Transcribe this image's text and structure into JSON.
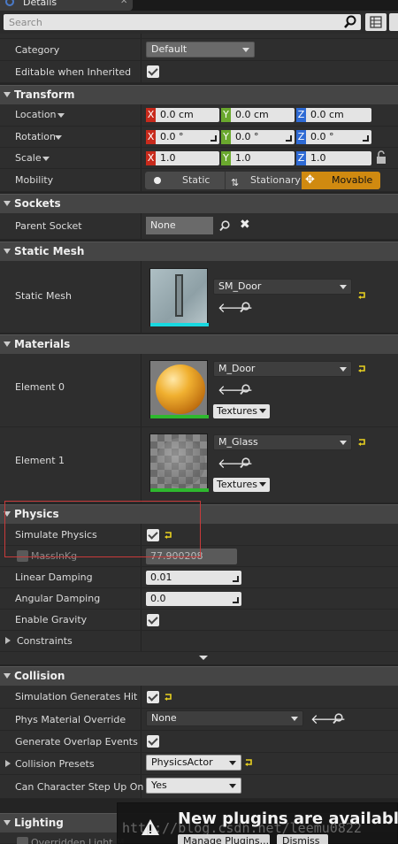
{
  "window": {
    "tab_title": "Details",
    "search_placeholder": "Search"
  },
  "top": {
    "category": {
      "label": "Category",
      "value": "Default"
    },
    "editable_inherited": {
      "label": "Editable when Inherited",
      "checked": true
    }
  },
  "transform": {
    "title": "Transform",
    "location": {
      "label": "Location",
      "x": "0.0 cm",
      "y": "0.0 cm",
      "z": "0.0 cm"
    },
    "rotation": {
      "label": "Rotation",
      "x": "0.0 °",
      "y": "0.0 °",
      "z": "0.0 °"
    },
    "scale": {
      "label": "Scale",
      "x": "1.0",
      "y": "1.0",
      "z": "1.0"
    },
    "axis_x": "X",
    "axis_y": "Y",
    "axis_z": "Z",
    "mobility": {
      "label": "Mobility",
      "options": [
        "Static",
        "Stationary",
        "Movable"
      ],
      "selected": "Movable"
    }
  },
  "sockets": {
    "title": "Sockets",
    "parent_socket": {
      "label": "Parent Socket",
      "value": "None"
    }
  },
  "static_mesh": {
    "title": "Static Mesh",
    "label": "Static Mesh",
    "value": "SM_Door"
  },
  "materials": {
    "title": "Materials",
    "elements": [
      {
        "label": "Element 0",
        "value": "M_Door",
        "textures": "Textures"
      },
      {
        "label": "Element 1",
        "value": "M_Glass",
        "textures": "Textures"
      }
    ]
  },
  "physics": {
    "title": "Physics",
    "simulate": {
      "label": "Simulate Physics",
      "checked": true
    },
    "mass": {
      "label": "MassInKg",
      "value": "77.900208"
    },
    "linear_damping": {
      "label": "Linear Damping",
      "value": "0.01"
    },
    "angular_damping": {
      "label": "Angular Damping",
      "value": "0.0"
    },
    "gravity": {
      "label": "Enable Gravity",
      "checked": true
    },
    "constraints": {
      "label": "Constraints"
    }
  },
  "collision": {
    "title": "Collision",
    "hit_events": {
      "label": "Simulation Generates Hit Ev",
      "checked": true
    },
    "phys_material": {
      "label": "Phys Material Override",
      "value": "None"
    },
    "overlap": {
      "label": "Generate Overlap Events",
      "checked": true
    },
    "presets": {
      "label": "Collision Presets",
      "value": "PhysicsActor"
    },
    "step_up": {
      "label": "Can Character Step Up On",
      "value": "Yes"
    }
  },
  "lighting": {
    "title": "Lighting",
    "sub_label": "Overridden Light M"
  },
  "notification": {
    "title": "New plugins are available",
    "manage_button": "Manage Plugins...",
    "dismiss_button": "Dismiss"
  },
  "watermark": "http://blog.csdn.net/leemu0822",
  "colors": {
    "accent_movable": "#d08a10",
    "highlight_box": "#c83a3a",
    "reset_arrow": "#e8d020"
  }
}
